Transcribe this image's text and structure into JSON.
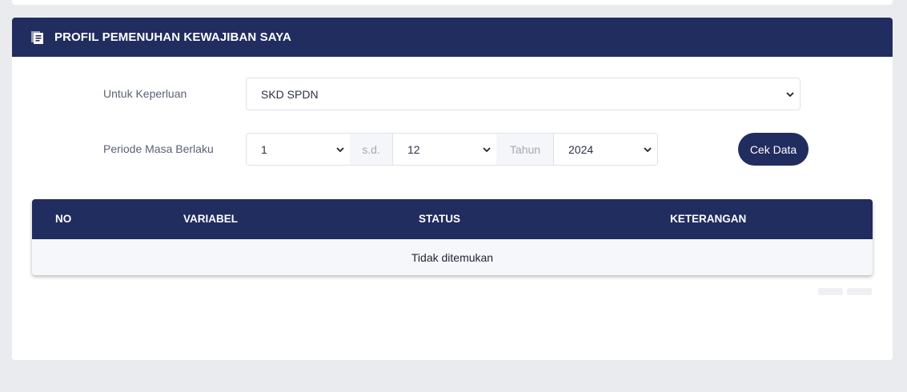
{
  "panel": {
    "title": "PROFIL PEMENUHAN KEWAJIBAN SAYA",
    "icon": "document-icon"
  },
  "form": {
    "keperluan": {
      "label": "Untuk Keperluan",
      "value": "SKD SPDN"
    },
    "periode": {
      "label": "Periode Masa Berlaku",
      "masa_awal": "1",
      "separator": "s.d.",
      "masa_akhir": "12",
      "tahun_label": "Tahun",
      "tahun": "2024"
    },
    "submit_label": "Cek Data"
  },
  "table": {
    "columns": [
      "NO",
      "VARIABEL",
      "STATUS",
      "KETERANGAN"
    ],
    "empty_message": "Tidak ditemukan"
  },
  "colors": {
    "primary": "#212c5f",
    "background": "#eaebef"
  }
}
